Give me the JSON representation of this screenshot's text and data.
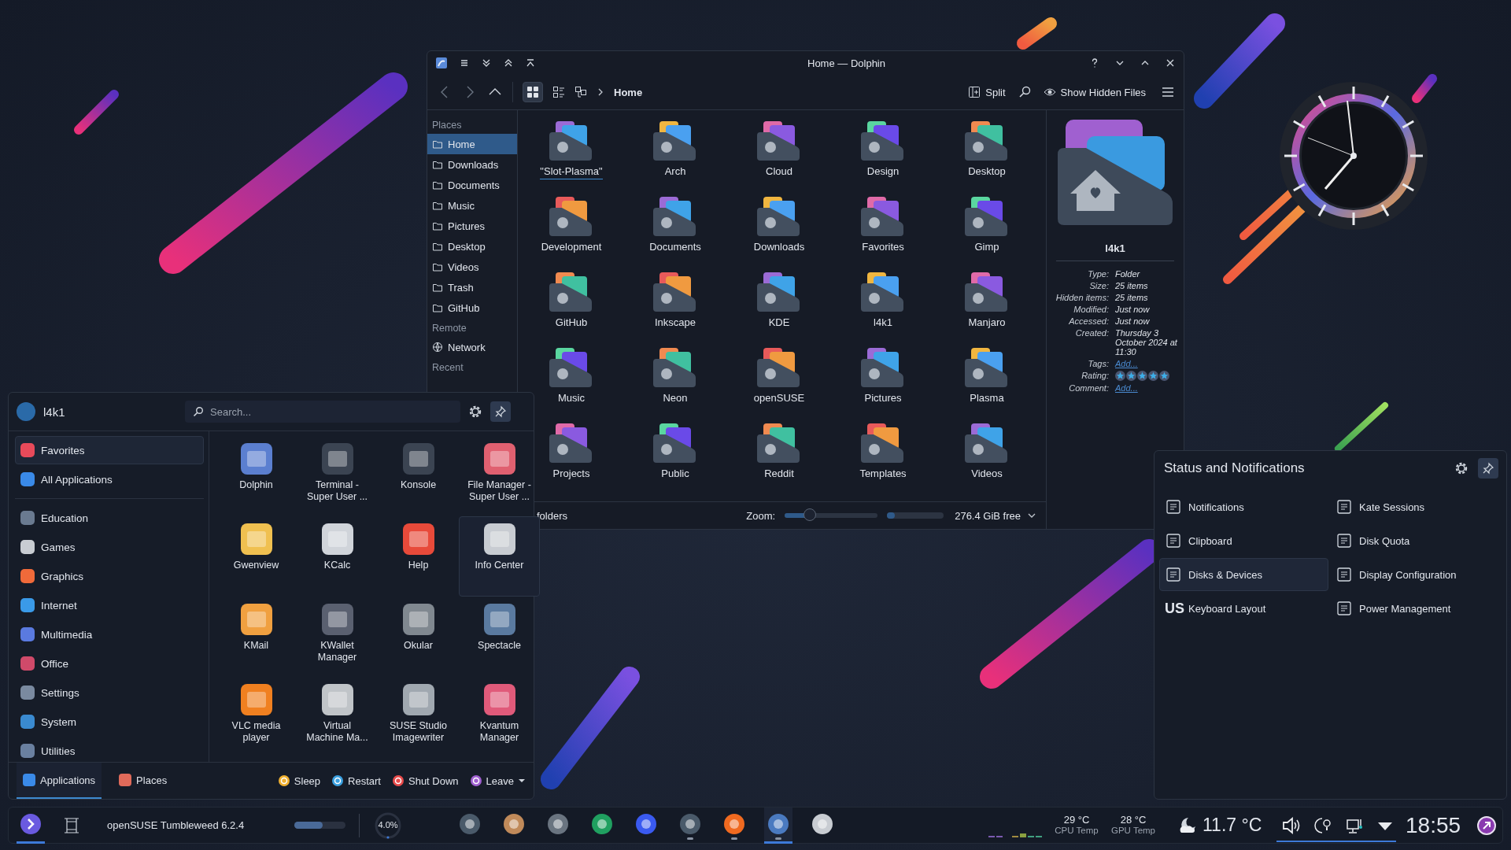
{
  "dolphin": {
    "title": "Home — Dolphin",
    "breadcrumb": "Home",
    "split_label": "Split",
    "hidden_label": "Show Hidden Files",
    "places_header": "Places",
    "places": [
      {
        "label": "Home",
        "selected": true
      },
      {
        "label": "Downloads",
        "selected": false
      },
      {
        "label": "Documents",
        "selected": false
      },
      {
        "label": "Music",
        "selected": false
      },
      {
        "label": "Pictures",
        "selected": false
      },
      {
        "label": "Desktop",
        "selected": false
      },
      {
        "label": "Videos",
        "selected": false
      },
      {
        "label": "Trash",
        "selected": false
      },
      {
        "label": "GitHub",
        "selected": false
      }
    ],
    "remote_header": "Remote",
    "remote": [
      {
        "label": "Network",
        "selected": false
      }
    ],
    "recent_header": "Recent",
    "folders": [
      {
        "name": "\"Slot-Plasma\"",
        "focused": true
      },
      {
        "name": "Arch",
        "focused": false
      },
      {
        "name": "Cloud",
        "focused": false
      },
      {
        "name": "Design",
        "focused": false
      },
      {
        "name": "Desktop",
        "focused": false
      },
      {
        "name": "Development",
        "focused": false
      },
      {
        "name": "Documents",
        "focused": false
      },
      {
        "name": "Downloads",
        "focused": false
      },
      {
        "name": "Favorites",
        "focused": false
      },
      {
        "name": "Gimp",
        "focused": false
      },
      {
        "name": "GitHub",
        "focused": false
      },
      {
        "name": "Inkscape",
        "focused": false
      },
      {
        "name": "KDE",
        "focused": false
      },
      {
        "name": "l4k1",
        "focused": false
      },
      {
        "name": "Manjaro",
        "focused": false
      },
      {
        "name": "Music",
        "focused": false
      },
      {
        "name": "Neon",
        "focused": false
      },
      {
        "name": "openSUSE",
        "focused": false
      },
      {
        "name": "Pictures",
        "focused": false
      },
      {
        "name": "Plasma",
        "focused": false
      },
      {
        "name": "Projects",
        "focused": false
      },
      {
        "name": "Public",
        "focused": false
      },
      {
        "name": "Reddit",
        "focused": false
      },
      {
        "name": "Templates",
        "focused": false
      },
      {
        "name": "Videos",
        "focused": false
      }
    ],
    "status": "folders",
    "zoom_label": "Zoom:",
    "zoom": {
      "level": 0.28
    },
    "space": {
      "level": 0.14
    },
    "free": "276.4 GiB free",
    "info": {
      "name": "l4k1",
      "properties": [
        {
          "kind": "text",
          "label": "Type:",
          "value": "Folder"
        },
        {
          "kind": "text",
          "label": "Size:",
          "value": "25 items"
        },
        {
          "kind": "text",
          "label": "Hidden items:",
          "value": "25 items"
        },
        {
          "kind": "text",
          "label": "Modified:",
          "value": "Just now"
        },
        {
          "kind": "text",
          "label": "Accessed:",
          "value": "Just now"
        },
        {
          "kind": "text",
          "label": "Created:",
          "value": "Thursday 3 October 2024 at 11:30"
        },
        {
          "kind": "link",
          "label": "Tags:",
          "value": "Add..."
        },
        {
          "kind": "rating",
          "label": "Rating:",
          "stars": 5
        },
        {
          "kind": "link",
          "label": "Comment:",
          "value": "Add..."
        }
      ]
    }
  },
  "launcher": {
    "user": "l4k1",
    "search": {
      "placeholder": "Search..."
    },
    "categories": [
      {
        "label": "Favorites",
        "selected": true
      },
      {
        "label": "All Applications",
        "selected": false
      },
      {
        "label": "Education",
        "selected": false
      },
      {
        "label": "Games",
        "selected": false
      },
      {
        "label": "Graphics",
        "selected": false
      },
      {
        "label": "Internet",
        "selected": false
      },
      {
        "label": "Multimedia",
        "selected": false
      },
      {
        "label": "Office",
        "selected": false
      },
      {
        "label": "Settings",
        "selected": false
      },
      {
        "label": "System",
        "selected": false
      },
      {
        "label": "Utilities",
        "selected": false
      }
    ],
    "apps": [
      {
        "name": "Dolphin",
        "highlighted": false
      },
      {
        "name": "Terminal -\nSuper User ...",
        "highlighted": false
      },
      {
        "name": "Konsole",
        "highlighted": false
      },
      {
        "name": "File Manager -\nSuper User ...",
        "highlighted": false
      },
      {
        "name": "Gwenview",
        "highlighted": false
      },
      {
        "name": "KCalc",
        "highlighted": false
      },
      {
        "name": "Help",
        "highlighted": false
      },
      {
        "name": "Info Center",
        "highlighted": true
      },
      {
        "name": "KMail",
        "highlighted": false
      },
      {
        "name": "KWallet\nManager",
        "highlighted": false
      },
      {
        "name": "Okular",
        "highlighted": false
      },
      {
        "name": "Spectacle",
        "highlighted": false
      },
      {
        "name": "VLC media\nplayer",
        "highlighted": false
      },
      {
        "name": "Virtual\nMachine Ma...",
        "highlighted": false
      },
      {
        "name": "SUSE Studio\nImagewriter",
        "highlighted": false
      },
      {
        "name": "Kvantum\nManager",
        "highlighted": false
      }
    ],
    "tabs": [
      {
        "label": "Applications",
        "selected": true
      },
      {
        "label": "Places",
        "selected": false
      }
    ],
    "actions": [
      "Sleep",
      "Restart",
      "Shut Down",
      "Leave"
    ]
  },
  "status_panel": {
    "title": "Status and Notifications",
    "items": [
      {
        "label": "Notifications",
        "selected": false
      },
      {
        "label": "Kate Sessions",
        "selected": false
      },
      {
        "label": "Clipboard",
        "selected": false
      },
      {
        "label": "Disk Quota",
        "selected": false
      },
      {
        "label": "Disks & Devices",
        "selected": true
      },
      {
        "label": "Display Configuration",
        "selected": false
      },
      {
        "label": "Keyboard Layout",
        "icon_text": "US",
        "selected": false
      },
      {
        "label": "Power Management",
        "selected": false
      }
    ]
  },
  "taskbar": {
    "launcher_open": true,
    "distro": "openSUSE Tumbleweed 6.2.4",
    "meter": {
      "level": 0.55
    },
    "cpu": {
      "reading": "4.0%"
    },
    "tasks": [
      {
        "running": false,
        "active": false
      },
      {
        "running": false,
        "active": false
      },
      {
        "running": false,
        "active": false
      },
      {
        "running": false,
        "active": false
      },
      {
        "running": false,
        "active": false
      },
      {
        "running": true,
        "active": false
      },
      {
        "running": true,
        "active": false
      },
      {
        "running": true,
        "active": true
      },
      {
        "running": false,
        "active": false
      }
    ],
    "temps": [
      {
        "value": "29 °C",
        "label": "CPU Temp"
      },
      {
        "value": "28 °C",
        "label": "GPU Temp"
      }
    ],
    "weather": "11.7 °C",
    "tray_expanded": true,
    "clock": "18:55"
  }
}
